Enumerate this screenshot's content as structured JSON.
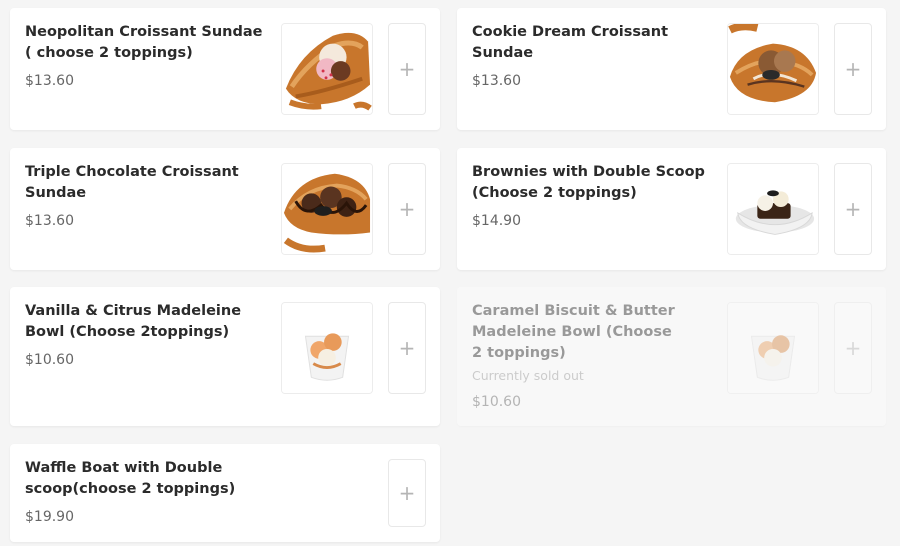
{
  "menu_items": [
    {
      "name": "Neopolitan Croissant Sundae ( choose 2 toppings)",
      "price": "$13.60"
    },
    {
      "name": "Cookie Dream Croissant Sundae",
      "price": "$13.60"
    },
    {
      "name": "Triple Chocolate Croissant Sundae",
      "price": "$13.60"
    },
    {
      "name": "Brownies with Double Scoop (Choose 2 toppings)",
      "price": "$14.90"
    },
    {
      "name": "Vanilla & Citrus Madeleine Bowl (Choose 2toppings)",
      "price": "$10.60"
    },
    {
      "name": "Caramel Biscuit & Butter Madeleine Bowl (Choose 2 toppings)",
      "status": "Currently sold out",
      "price": "$10.60"
    },
    {
      "name": "Waffle Boat with Double scoop(choose 2 toppings)",
      "price": "$19.90"
    }
  ],
  "add_button": {
    "icon": "plus-icon",
    "label": "+"
  },
  "colors": {
    "page_background": "#f5f5f5",
    "card_background": "#ffffff",
    "title_text": "#2b2b2b",
    "price_text": "#666666",
    "muted_text": "#999999",
    "plus_icon": "#b5b5b5"
  }
}
